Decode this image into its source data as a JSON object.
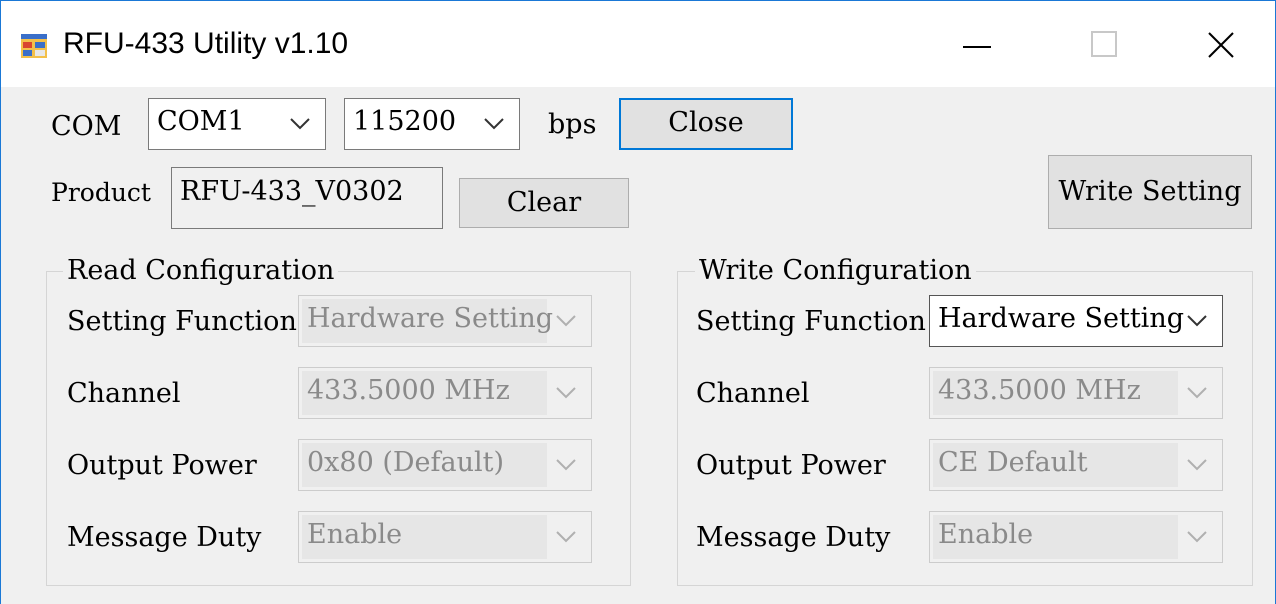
{
  "window": {
    "title": "RFU-433 Utility v1.10"
  },
  "titlebar": {
    "icons": [
      "app-icon",
      "minimize-icon",
      "maximize-icon",
      "close-icon"
    ]
  },
  "connection": {
    "com_label": "COM",
    "port_value": "COM1",
    "baud_value": "115200",
    "bps_label": "bps",
    "close_button": "Close"
  },
  "product": {
    "label": "Product",
    "value": "RFU-433_V0302",
    "clear_button": "Clear"
  },
  "write_setting_button": "Write Setting",
  "read_config": {
    "title": "Read Configuration",
    "setting_function_label": "Setting Function",
    "setting_function_value": "Hardware Setting",
    "channel_label": "Channel",
    "channel_value": "433.5000 MHz",
    "output_power_label": "Output Power",
    "output_power_value": "0x80 (Default)",
    "message_duty_label": "Message Duty",
    "message_duty_value": "Enable"
  },
  "write_config": {
    "title": "Write Configuration",
    "setting_function_label": "Setting Function",
    "setting_function_value": "Hardware Setting",
    "channel_label": "Channel",
    "channel_value": "433.5000 MHz",
    "output_power_label": "Output Power",
    "output_power_value": "CE Default",
    "message_duty_label": "Message Duty",
    "message_duty_value": "Enable"
  },
  "colors": {
    "window_border": "#1a78d6",
    "focus_border": "#0078d7",
    "dialog_bg": "#f0f0f0",
    "disabled_text": "#8a8a8a"
  }
}
